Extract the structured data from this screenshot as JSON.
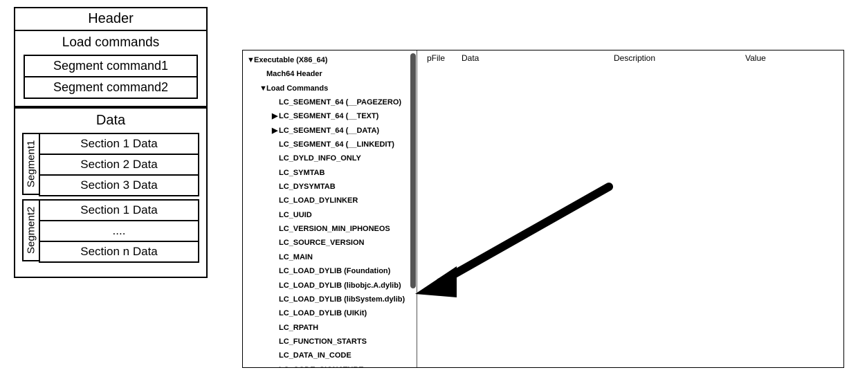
{
  "diagram": {
    "header": "Header",
    "load_commands_title": "Load commands",
    "segment_commands": [
      "Segment command1",
      "Segment command2"
    ],
    "data_title": "Data",
    "segments": [
      {
        "label": "Segment1",
        "rows": [
          "Section 1 Data",
          "Section 2 Data",
          "Section 3 Data"
        ]
      },
      {
        "label": "Segment2",
        "rows": [
          "Section 1 Data",
          "....",
          "Section n Data"
        ]
      }
    ]
  },
  "panel": {
    "columns": {
      "pfile": "pFile",
      "data": "Data",
      "description": "Description",
      "value": "Value"
    },
    "tree": [
      {
        "label": "Executable (X86_64)",
        "depth": 0,
        "disclosure": "▼"
      },
      {
        "label": "Mach64 Header",
        "depth": 1,
        "disclosure": ""
      },
      {
        "label": "Load Commands",
        "depth": 1,
        "disclosure": "▼"
      },
      {
        "label": "LC_SEGMENT_64 (__PAGEZERO)",
        "depth": 2,
        "disclosure": ""
      },
      {
        "label": "LC_SEGMENT_64 (__TEXT)",
        "depth": 2,
        "disclosure": "▶"
      },
      {
        "label": "LC_SEGMENT_64 (__DATA)",
        "depth": 2,
        "disclosure": "▶"
      },
      {
        "label": "LC_SEGMENT_64 (__LINKEDIT)",
        "depth": 2,
        "disclosure": ""
      },
      {
        "label": "LC_DYLD_INFO_ONLY",
        "depth": 2,
        "disclosure": ""
      },
      {
        "label": "LC_SYMTAB",
        "depth": 2,
        "disclosure": ""
      },
      {
        "label": "LC_DYSYMTAB",
        "depth": 2,
        "disclosure": ""
      },
      {
        "label": "LC_LOAD_DYLINKER",
        "depth": 2,
        "disclosure": ""
      },
      {
        "label": "LC_UUID",
        "depth": 2,
        "disclosure": ""
      },
      {
        "label": "LC_VERSION_MIN_IPHONEOS",
        "depth": 2,
        "disclosure": ""
      },
      {
        "label": "LC_SOURCE_VERSION",
        "depth": 2,
        "disclosure": ""
      },
      {
        "label": "LC_MAIN",
        "depth": 2,
        "disclosure": ""
      },
      {
        "label": "LC_LOAD_DYLIB (Foundation)",
        "depth": 2,
        "disclosure": ""
      },
      {
        "label": "LC_LOAD_DYLIB (libobjc.A.dylib)",
        "depth": 2,
        "disclosure": ""
      },
      {
        "label": "LC_LOAD_DYLIB (libSystem.dylib)",
        "depth": 2,
        "disclosure": ""
      },
      {
        "label": "LC_LOAD_DYLIB (UIKit)",
        "depth": 2,
        "disclosure": ""
      },
      {
        "label": "LC_RPATH",
        "depth": 2,
        "disclosure": ""
      },
      {
        "label": "LC_FUNCTION_STARTS",
        "depth": 2,
        "disclosure": ""
      },
      {
        "label": "LC_DATA_IN_CODE",
        "depth": 2,
        "disclosure": ""
      },
      {
        "label": "LC_CODE_SIGNATURE",
        "depth": 2,
        "disclosure": ""
      }
    ]
  },
  "arrow_target_index": 16
}
